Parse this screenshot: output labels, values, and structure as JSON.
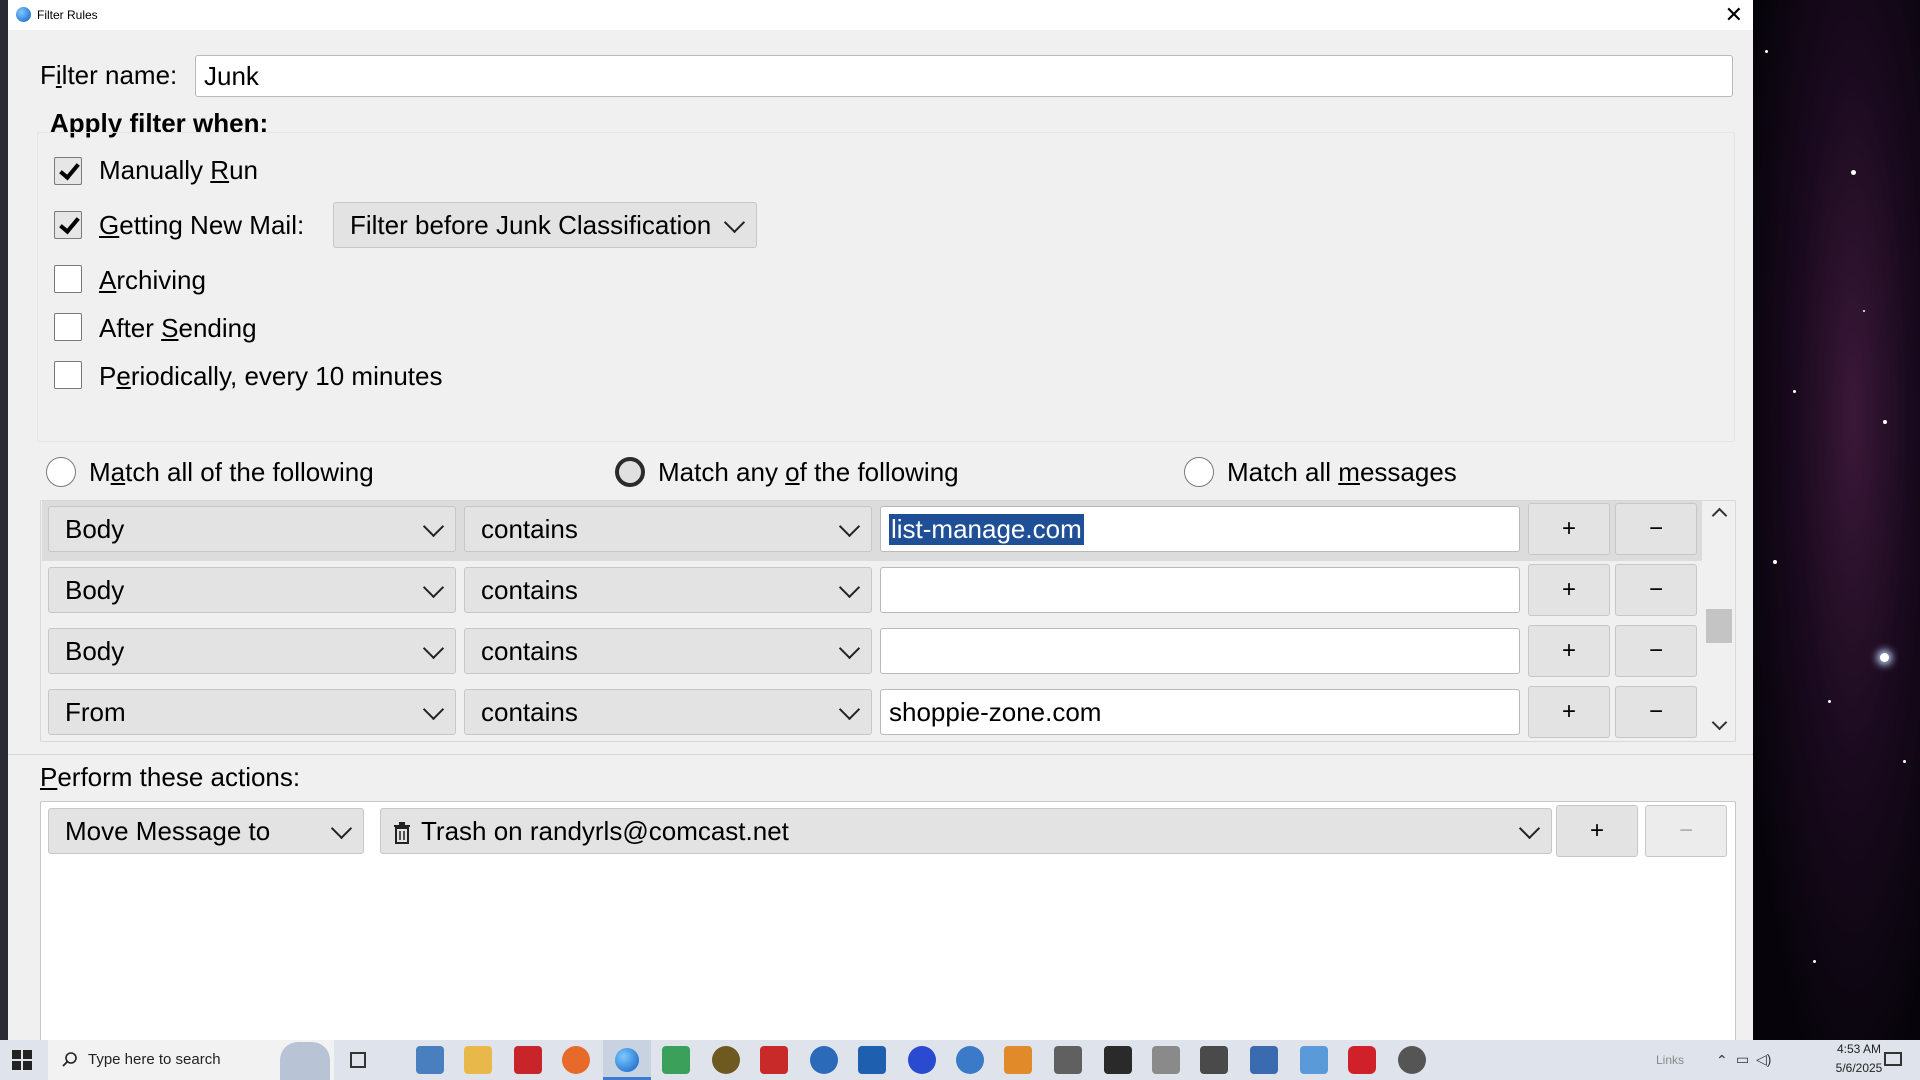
{
  "window": {
    "title": "Filter Rules",
    "close_glyph": "✕"
  },
  "filter_name": {
    "label_pre": "F",
    "label_ul": "i",
    "label_post": "lter name:",
    "value": "Junk"
  },
  "apply_when": {
    "heading": "Apply filter when:",
    "options": [
      {
        "pre": "Manually ",
        "ul": "R",
        "post": "un",
        "checked": true
      },
      {
        "pre": "",
        "ul": "G",
        "post": "etting New Mail:",
        "checked": true
      },
      {
        "pre": "",
        "ul": "A",
        "post": "rchiving",
        "checked": false
      },
      {
        "pre": "After ",
        "ul": "S",
        "post": "ending",
        "checked": false
      },
      {
        "pre": "P",
        "ul": "e",
        "post": "riodically, every 10 minutes",
        "checked": false
      }
    ],
    "new_mail_timing": "Filter before Junk Classification"
  },
  "match": {
    "all": {
      "pre": "M",
      "ul": "a",
      "post": "tch all of the following"
    },
    "any": {
      "pre": "Match any ",
      "ul": "o",
      "post": "f the following"
    },
    "everything": {
      "pre": "Match all ",
      "ul": "m",
      "post": "essages"
    },
    "selected": "any"
  },
  "rules": [
    {
      "field": "Body",
      "op": "contains",
      "value": "list-manage.com"
    },
    {
      "field": "Body",
      "op": "contains",
      "value": ""
    },
    {
      "field": "Body",
      "op": "contains",
      "value": ""
    },
    {
      "field": "From",
      "op": "contains",
      "value": "shoppie-zone.com"
    }
  ],
  "buttons": {
    "add": "+",
    "remove": "−"
  },
  "actions": {
    "heading_ul": "P",
    "heading_post": "erform these actions:",
    "items": [
      {
        "action": "Move Message to",
        "target": "Trash on randyrls@comcast.net"
      }
    ]
  },
  "taskbar": {
    "search_placeholder": "Type here to search",
    "links_label": "Links",
    "time": "4:53 AM",
    "date": "5/6/2025"
  },
  "icons": [
    "thunderbird-icon",
    "windows-start-icon",
    "search-icon",
    "task-view-icon",
    "trash-icon"
  ]
}
